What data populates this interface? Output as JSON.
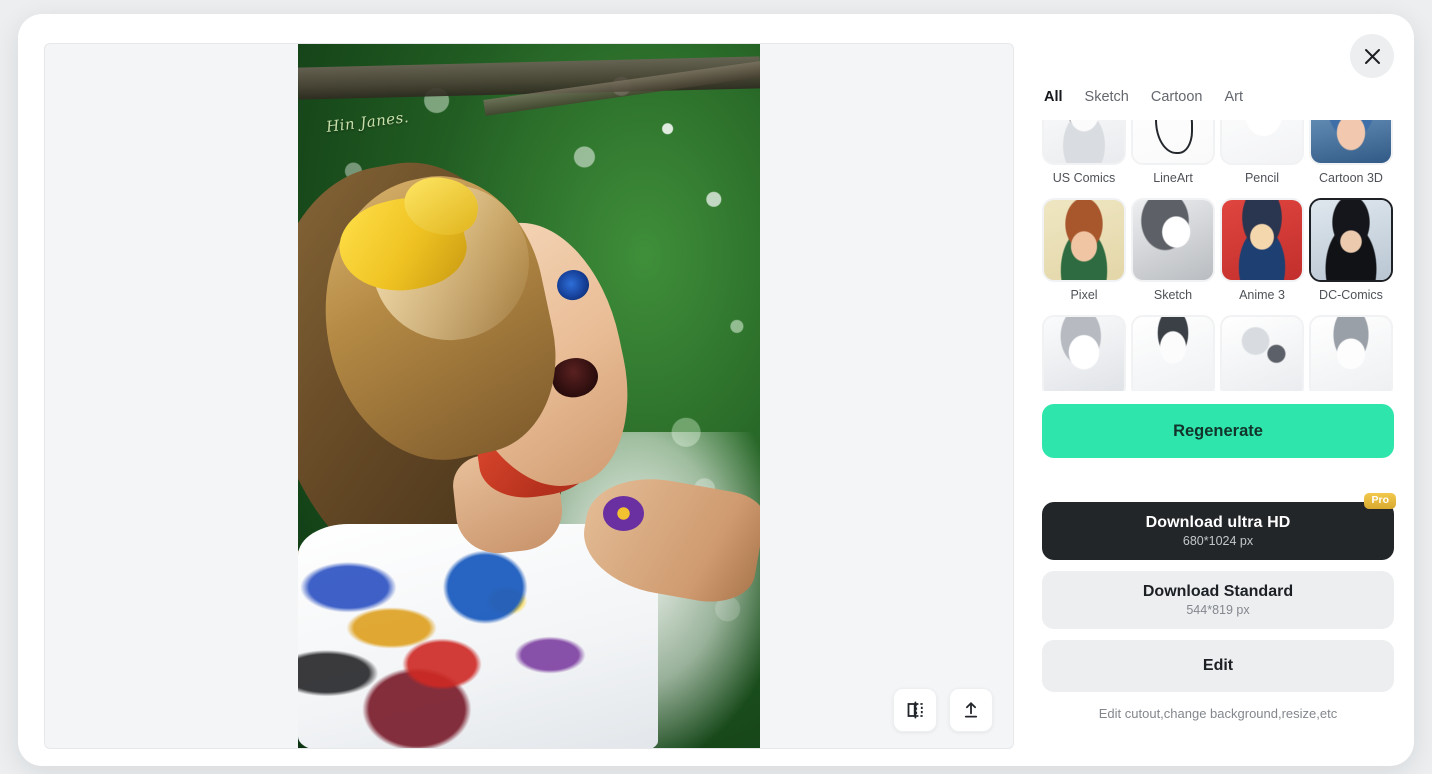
{
  "modal": {
    "close_label": "Close",
    "close_icon": "close-icon"
  },
  "preview": {
    "artwork_signature": "Hin\nJanes.",
    "actions": [
      {
        "name": "compare-button",
        "icon": "compare-split-icon",
        "label": "Compare"
      },
      {
        "name": "share-button",
        "icon": "upload-arrow-icon",
        "label": "Share"
      }
    ]
  },
  "rail": {
    "tabs": [
      {
        "label": "All",
        "active": true
      },
      {
        "label": "Sketch",
        "active": false
      },
      {
        "label": "Cartoon",
        "active": false
      },
      {
        "label": "Art",
        "active": false
      }
    ],
    "styles": [
      {
        "label": "US Comics",
        "selected": false,
        "art": "sk-uscomics"
      },
      {
        "label": "LineArt",
        "selected": false,
        "art": "sk-lineart"
      },
      {
        "label": "Pencil",
        "selected": false,
        "art": "sk-pencil"
      },
      {
        "label": "Cartoon 3D",
        "selected": false,
        "art": "sk-cartoon3d"
      },
      {
        "label": "Pixel",
        "selected": false,
        "art": "sk-pixel"
      },
      {
        "label": "Sketch",
        "selected": false,
        "art": "sk-sketch"
      },
      {
        "label": "Anime 3",
        "selected": false,
        "art": "sk-anime3"
      },
      {
        "label": "DC-Comics",
        "selected": true,
        "art": "sk-dccomics"
      },
      {
        "label": "",
        "selected": false,
        "art": "sk-portrait"
      },
      {
        "label": "",
        "selected": false,
        "art": "sk-man"
      },
      {
        "label": "",
        "selected": false,
        "art": "sk-still"
      },
      {
        "label": "",
        "selected": false,
        "art": "sk-smile"
      }
    ],
    "regenerate_label": "Regenerate",
    "download_ultra": {
      "title": "Download ultra HD",
      "size": "680*1024 px",
      "badge": "Pro"
    },
    "download_standard": {
      "title": "Download Standard",
      "size": "544*819 px"
    },
    "edit_label": "Edit",
    "edit_hint": "Edit cutout,change background,resize,etc"
  },
  "colors": {
    "accent": "#2EE6AC",
    "dark_button": "#232629",
    "light_button": "#ECEEF0",
    "pro_badge": "#E8B93B",
    "page_bg": "#ECEEF0"
  }
}
